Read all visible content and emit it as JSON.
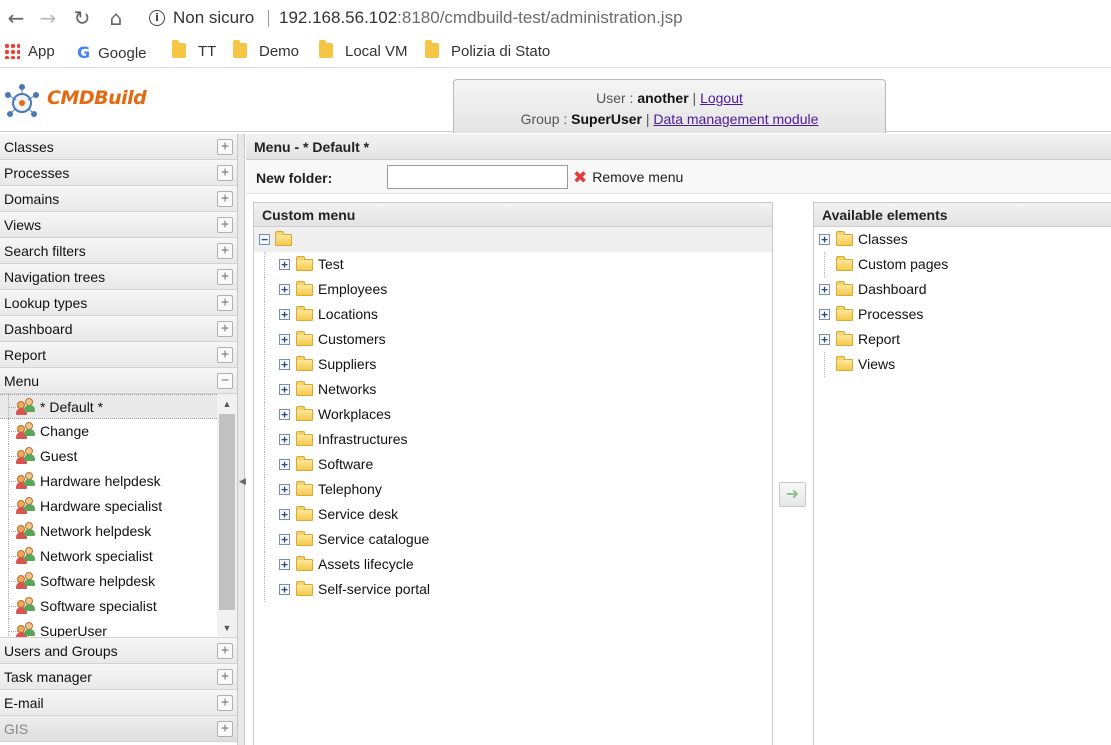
{
  "browser": {
    "security_label": "Non sicuro",
    "url_host": "192.168.56.102",
    "url_rest": ":8180/cmdbuild-test/administration.jsp",
    "bookmarks": [
      "App",
      "Google",
      "TT",
      "Demo",
      "Local VM",
      "Polizia di Stato"
    ]
  },
  "header": {
    "logo_text": "CMDBuild",
    "user_label": "User :",
    "user_name": "another",
    "logout": "Logout",
    "group_label": "Group :",
    "group_name": "SuperUser",
    "data_module": "Data management module"
  },
  "sidebar": {
    "sections_top": [
      "Classes",
      "Processes",
      "Domains",
      "Views",
      "Search filters",
      "Navigation trees",
      "Lookup types",
      "Dashboard",
      "Report"
    ],
    "menu_section": "Menu",
    "menu_items": [
      "* Default *",
      "Change",
      "Guest",
      "Hardware helpdesk",
      "Hardware specialist",
      "Network helpdesk",
      "Network specialist",
      "Software helpdesk",
      "Software specialist",
      "SuperUser"
    ],
    "sections_bottom": [
      "Users and Groups",
      "Task manager",
      "E-mail",
      "GIS"
    ]
  },
  "main": {
    "title": "Menu - * Default *",
    "new_folder_label": "New folder:",
    "new_folder_value": "",
    "remove_menu": "Remove menu",
    "custom_menu": {
      "title": "Custom menu",
      "items": [
        "Test",
        "Employees",
        "Locations",
        "Customers",
        "Suppliers",
        "Networks",
        "Workplaces",
        "Infrastructures",
        "Software",
        "Telephony",
        "Service desk",
        "Service catalogue",
        "Assets lifecycle",
        "Self-service portal"
      ]
    },
    "available": {
      "title": "Available elements",
      "items": [
        {
          "label": "Classes",
          "expandable": true
        },
        {
          "label": "Custom pages",
          "expandable": false
        },
        {
          "label": "Dashboard",
          "expandable": true
        },
        {
          "label": "Processes",
          "expandable": true
        },
        {
          "label": "Report",
          "expandable": true
        },
        {
          "label": "Views",
          "expandable": false
        }
      ]
    }
  }
}
